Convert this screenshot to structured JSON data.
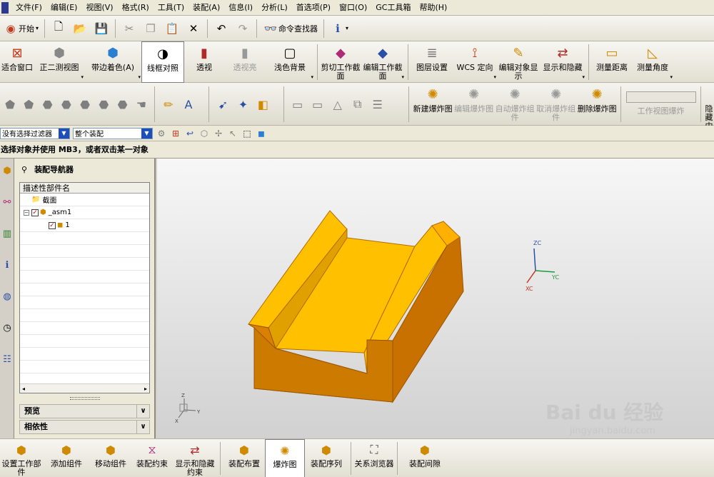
{
  "menubar": {
    "items": [
      "文件(F)",
      "编辑(E)",
      "视图(V)",
      "格式(R)",
      "工具(T)",
      "装配(A)",
      "信息(I)",
      "分析(L)",
      "首选项(P)",
      "窗口(O)",
      "GC工具箱",
      "帮助(H)"
    ]
  },
  "toolbar1": {
    "start_label": "开始",
    "command_finder_label": "命令查找器"
  },
  "toolbar2": {
    "buttons": [
      {
        "label": "适合窗口",
        "icon": "fit-window-icon"
      },
      {
        "label": "正二测视图",
        "icon": "trimetric-view-icon"
      },
      {
        "label": "带边着色(A)",
        "icon": "shaded-with-edges-icon"
      },
      {
        "label": "线框对照",
        "icon": "wireframe-contrast-icon"
      },
      {
        "label": "透视",
        "icon": "perspective-icon"
      },
      {
        "label": "透视亮",
        "icon": "perspective-bright-icon"
      },
      {
        "label": "浅色背景",
        "icon": "light-background-icon"
      },
      {
        "label": "剪切工作截面",
        "icon": "clip-section-icon"
      },
      {
        "label": "编辑工作截面",
        "icon": "edit-section-icon"
      },
      {
        "label": "图层设置",
        "icon": "layer-settings-icon"
      },
      {
        "label": "WCS 定向",
        "icon": "wcs-orient-icon"
      },
      {
        "label": "编辑对象显示",
        "icon": "edit-object-display-icon"
      },
      {
        "label": "显示和隐藏",
        "icon": "show-hide-icon"
      },
      {
        "label": "测量距离",
        "icon": "measure-distance-icon"
      },
      {
        "label": "测量角度",
        "icon": "measure-angle-icon"
      }
    ]
  },
  "toolbar3": {
    "buttons": [
      {
        "label": "新建爆炸图"
      },
      {
        "label": "编辑爆炸图"
      },
      {
        "label": "自动爆炸组件"
      },
      {
        "label": "取消爆炸组件"
      },
      {
        "label": "删除爆炸图"
      },
      {
        "label": "工作视图爆炸"
      },
      {
        "label": "隐藏中"
      }
    ]
  },
  "filterbar": {
    "filter_value": "没有选择过滤器",
    "scope_value": "整个装配"
  },
  "cue": {
    "text": "选择对象并使用 MB3，或者双击某一对象"
  },
  "navigator": {
    "title": "装配导航器",
    "column_header": "描述性部件名",
    "rows": [
      {
        "label": "截面",
        "level": 0,
        "checked": false,
        "expand": false,
        "icon": "folder-icon"
      },
      {
        "label": "_asm1",
        "level": 0,
        "checked": true,
        "expand": true,
        "icon": "assembly-icon"
      },
      {
        "label": "1",
        "level": 1,
        "checked": true,
        "expand": false,
        "icon": "part-icon"
      }
    ],
    "sections": [
      "预览",
      "相依性"
    ]
  },
  "viewport": {
    "triad_labels": {
      "z": "ZC",
      "y": "YC",
      "x": "XC"
    },
    "absolute_triad_labels": {
      "z": "Z",
      "y": "Y",
      "x": "X"
    },
    "part_color_top": "#ffc000",
    "part_color_front": "#cc7a00"
  },
  "bottombar": {
    "buttons": [
      {
        "label": "设置工作部件",
        "icon": "set-work-part-icon"
      },
      {
        "label": "添加组件",
        "icon": "add-component-icon"
      },
      {
        "label": "移动组件",
        "icon": "move-component-icon"
      },
      {
        "label": "装配约束",
        "icon": "assembly-constraint-icon"
      },
      {
        "label": "显示和隐藏约束",
        "icon": "show-hide-constraint-icon"
      },
      {
        "label": "装配布置",
        "icon": "assembly-arrangement-icon"
      },
      {
        "label": "爆炸图",
        "icon": "exploded-view-icon"
      },
      {
        "label": "装配序列",
        "icon": "assembly-sequence-icon"
      },
      {
        "label": "关系浏览器",
        "icon": "relationship-browser-icon"
      },
      {
        "label": "装配间隙",
        "icon": "assembly-clearance-icon"
      }
    ]
  },
  "watermark": {
    "brand": "Bai du 经验",
    "url": "jingyan.baidu.com"
  }
}
